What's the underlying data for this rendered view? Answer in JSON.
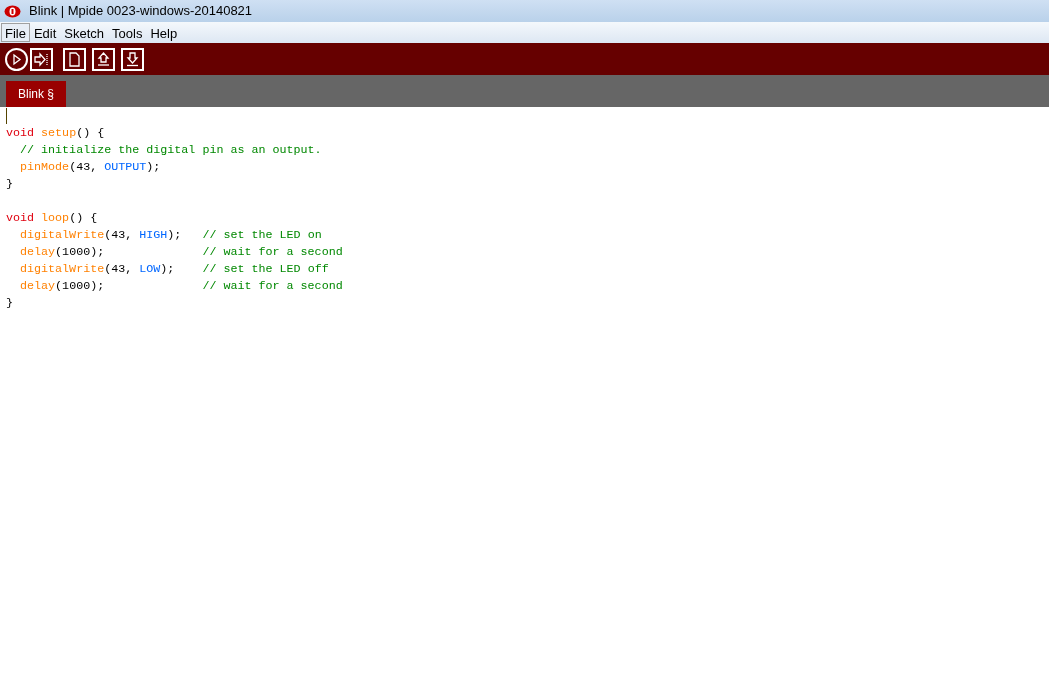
{
  "window": {
    "title": "Blink | Mpide 0023-windows-20140821"
  },
  "menu": [
    {
      "label": "File",
      "selected": true
    },
    {
      "label": "Edit",
      "selected": false
    },
    {
      "label": "Sketch",
      "selected": false
    },
    {
      "label": "Tools",
      "selected": false
    },
    {
      "label": "Help",
      "selected": false
    }
  ],
  "tabs": [
    {
      "label": "Blink §",
      "selected": true
    }
  ],
  "editor": {
    "blocks": [
      {
        "lines": [
          [
            {
              "kind": "keyword",
              "text": "void "
            },
            {
              "kind": "function",
              "text": "setup"
            },
            {
              "kind": "plain",
              "text": "() {"
            }
          ],
          [
            {
              "kind": "comment",
              "text": "  // initialize the digital pin as an output."
            }
          ],
          [
            {
              "kind": "function",
              "text": "  pinMode"
            },
            {
              "kind": "plain",
              "text": "(43, "
            },
            {
              "kind": "constant",
              "text": "OUTPUT"
            },
            {
              "kind": "plain",
              "text": ");"
            }
          ],
          [
            {
              "kind": "plain",
              "text": "}"
            }
          ]
        ]
      },
      {
        "lines": [
          [
            {
              "kind": "keyword",
              "text": "void "
            },
            {
              "kind": "function",
              "text": "loop"
            },
            {
              "kind": "plain",
              "text": "() {"
            }
          ],
          [
            {
              "kind": "function",
              "text": "  digitalWrite"
            },
            {
              "kind": "plain",
              "text": "(43, "
            },
            {
              "kind": "constant",
              "text": "HIGH"
            },
            {
              "kind": "plain",
              "text": ");   "
            },
            {
              "kind": "comment",
              "text": "// set the LED on"
            }
          ],
          [
            {
              "kind": "function",
              "text": "  delay"
            },
            {
              "kind": "plain",
              "text": "(1000);              "
            },
            {
              "kind": "comment",
              "text": "// wait for a second"
            }
          ],
          [
            {
              "kind": "function",
              "text": "  digitalWrite"
            },
            {
              "kind": "plain",
              "text": "(43, "
            },
            {
              "kind": "constant",
              "text": "LOW"
            },
            {
              "kind": "plain",
              "text": ");    "
            },
            {
              "kind": "comment",
              "text": "// set the LED off"
            }
          ],
          [
            {
              "kind": "function",
              "text": "  delay"
            },
            {
              "kind": "plain",
              "text": "(1000);              "
            },
            {
              "kind": "comment",
              "text": "// wait for a second"
            }
          ],
          [
            {
              "kind": "plain",
              "text": "}"
            }
          ]
        ]
      }
    ]
  }
}
